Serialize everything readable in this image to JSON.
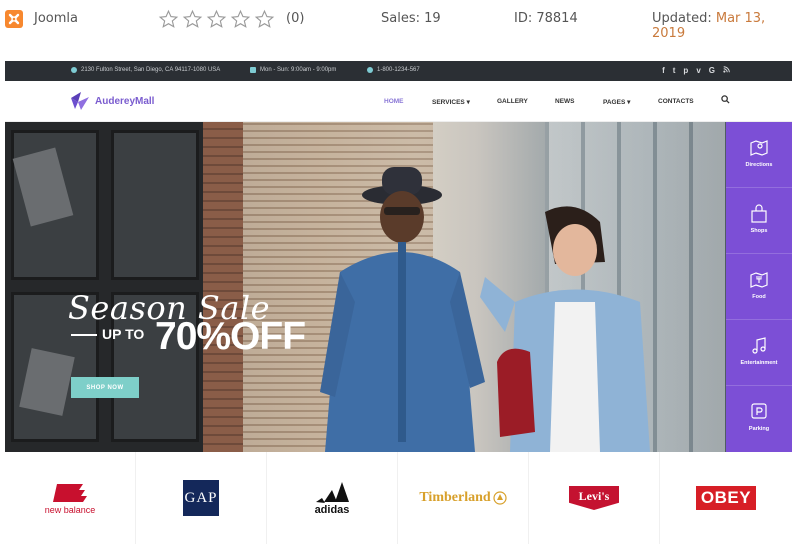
{
  "listing": {
    "platform": "Joomla",
    "rating_count": "(0)",
    "stars": 0,
    "stars_total": 5,
    "sales": "Sales: 19",
    "id": "ID: 78814",
    "updated_label": "Updated:",
    "updated_date": "Mar 13, 2019"
  },
  "topbar": {
    "address": "2130 Fulton Street, San Diego, CA 94117-1080 USA",
    "hours": "Mon - Sun: 9:00am - 9:00pm",
    "phone": "1-800-1234-567",
    "socials": [
      "f",
      "t",
      "p",
      "v",
      "G",
      "rss"
    ]
  },
  "logo": "AudereyMall",
  "nav": [
    "HOME",
    "SERVICES",
    "GALLERY",
    "NEWS",
    "PAGES",
    "CONTACTS"
  ],
  "hero": {
    "title": "Season Sale",
    "upto": "UP TO",
    "offer": "70%OFF",
    "button": "SHOP NOW",
    "slides": 3,
    "active_slide": 1
  },
  "sidebar": [
    "Directions",
    "Shops",
    "Food",
    "Entertainment",
    "Parking"
  ],
  "brands": [
    "new balance",
    "GAP",
    "adidas",
    "Timberland",
    "Levi's",
    "OBEY"
  ],
  "colors": {
    "accent": "#7c4fd6",
    "teal": "#7ecfc9",
    "orange": "#f7882f"
  }
}
